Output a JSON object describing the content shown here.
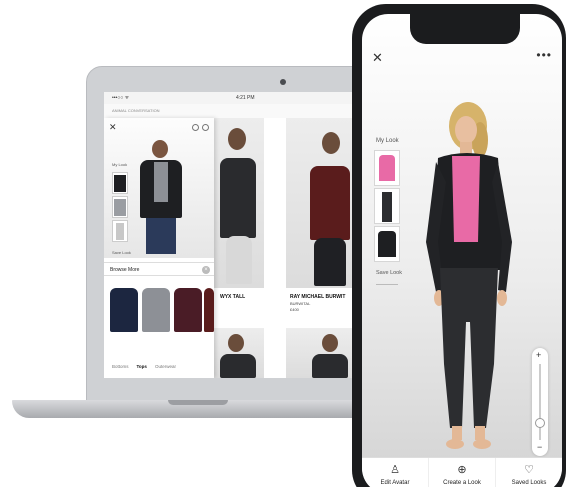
{
  "laptop": {
    "status": {
      "left": "•••○○ ᯤ",
      "time": "4:21 PM"
    },
    "sub_header": "ANIMAL CONVERSATION",
    "panel": {
      "my_look_label": "My Look",
      "save_look_label": "Save Look",
      "browse_more_label": "Browse More",
      "categories": [
        "Bottoms",
        "Tops",
        "Outerwear"
      ],
      "active_category": "Tops"
    },
    "products": [
      {
        "name": "WYX TALL"
      },
      {
        "name": "RAY MICHAEL BURWIT",
        "sub1": "BURWITAL",
        "sub2": "£400"
      }
    ]
  },
  "phone": {
    "my_look_label": "My Look",
    "save_look_label": "Save Look",
    "zoom": {
      "plus": "+",
      "minus": "−"
    },
    "nav": [
      {
        "label": "Edit Avatar",
        "icon": "avatar-icon"
      },
      {
        "label": "Create a Look",
        "icon": "plus-circle-icon"
      },
      {
        "label": "Saved Looks",
        "icon": "heart-icon"
      }
    ]
  },
  "colors": {
    "jacket": "#1e1f22",
    "tshirt_pink": "#e86aa6",
    "jeans": "#2c2d30",
    "hair": "#d6b36a",
    "maroon_jacket": "#5a1c1c",
    "navy": "#1c2640",
    "grey": "#8d9096",
    "burgundy": "#4a1c26"
  }
}
